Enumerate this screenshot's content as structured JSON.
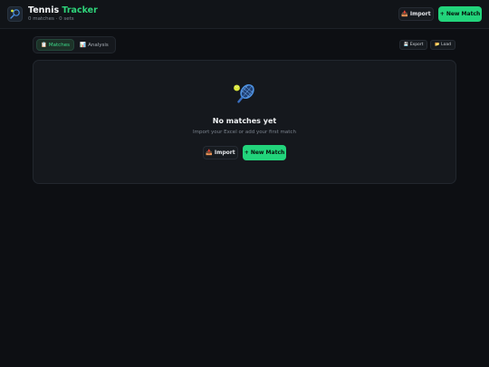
{
  "header": {
    "title_main": "Tennis",
    "title_accent": "Tracker",
    "subtitle": "0 matches · 0 sets",
    "import_icon": "📥",
    "import_label": "Import",
    "new_match_label": "+ New Match"
  },
  "tabs": [
    {
      "icon": "📋",
      "label": "Matches",
      "active": true
    },
    {
      "icon": "📊",
      "label": "Analysis",
      "active": false
    }
  ],
  "actions": {
    "export_icon": "💾",
    "export_label": "Export",
    "load_icon": "📂",
    "load_label": "Load"
  },
  "empty_state": {
    "icon": "tennis-racket-icon",
    "title": "No matches yet",
    "subtitle": "Import your Excel or add your first match",
    "import_icon": "📥",
    "import_label": "Import",
    "new_match_label": "+ New Match"
  },
  "colors": {
    "accent": "#22d47b",
    "background": "#0d0f13",
    "card": "#15181d"
  }
}
